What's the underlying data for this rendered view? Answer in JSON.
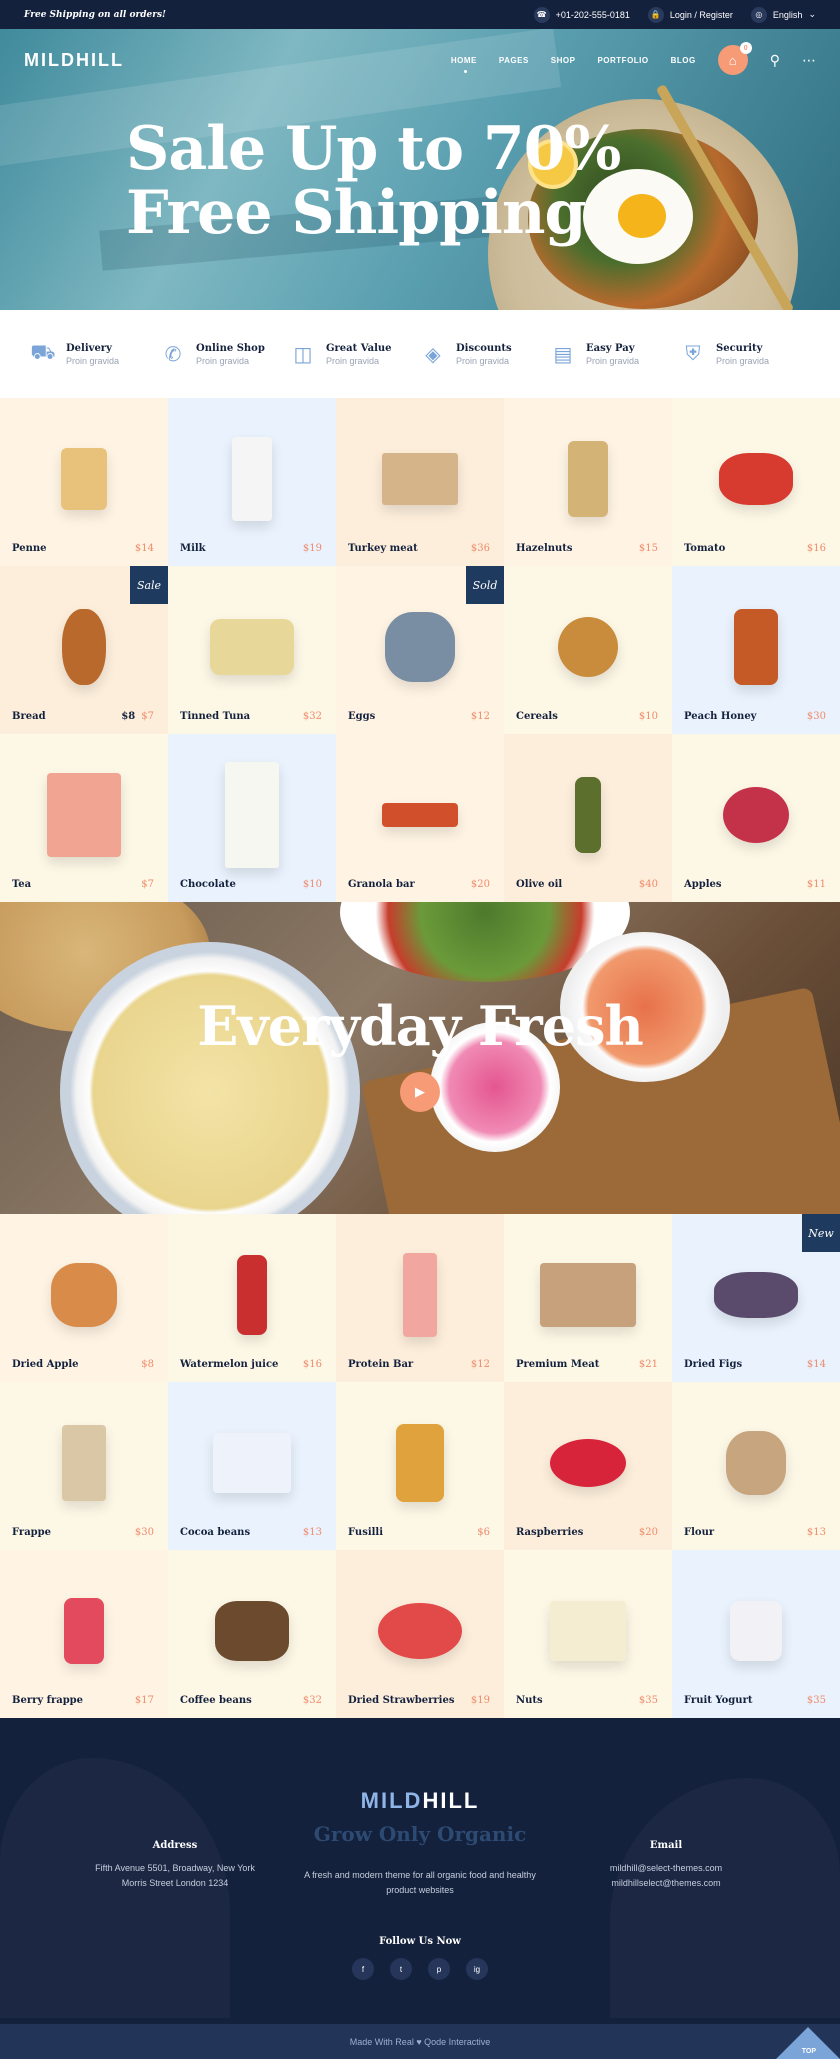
{
  "topbar": {
    "promo": "Free Shipping on all orders!",
    "phone": "+01-202-555-0181",
    "login": "Login / Register",
    "language": "English"
  },
  "header": {
    "logo": "MILDHILL",
    "nav": [
      "HOME",
      "PAGES",
      "SHOP",
      "PORTFOLIO",
      "BLOG"
    ],
    "cart_count": "0"
  },
  "hero": {
    "line1": "Sale Up to 70%",
    "line2": "Free Shipping"
  },
  "features": [
    {
      "title": "Delivery",
      "sub": "Proin gravida",
      "icon": "truck-icon"
    },
    {
      "title": "Online Shop",
      "sub": "Proin gravida",
      "icon": "phone-24-icon"
    },
    {
      "title": "Great Value",
      "sub": "Proin gravida",
      "icon": "box-icon"
    },
    {
      "title": "Discounts",
      "sub": "Proin gravida",
      "icon": "tag-icon"
    },
    {
      "title": "Easy Pay",
      "sub": "Proin gravida",
      "icon": "card-icon"
    },
    {
      "title": "Security",
      "sub": "Proin gravida",
      "icon": "shield-icon"
    }
  ],
  "products_top": [
    {
      "name": "Penne",
      "price": "$14",
      "old": "",
      "badge": ""
    },
    {
      "name": "Milk",
      "price": "$19",
      "old": "",
      "badge": ""
    },
    {
      "name": "Turkey meat",
      "price": "$36",
      "old": "",
      "badge": ""
    },
    {
      "name": "Hazelnuts",
      "price": "$15",
      "old": "",
      "badge": ""
    },
    {
      "name": "Tomato",
      "price": "$16",
      "old": "",
      "badge": ""
    },
    {
      "name": "Bread",
      "price": "$7",
      "old": "$8",
      "badge": "Sale"
    },
    {
      "name": "Tinned Tuna",
      "price": "$32",
      "old": "",
      "badge": ""
    },
    {
      "name": "Eggs",
      "price": "$12",
      "old": "",
      "badge": "Sold"
    },
    {
      "name": "Cereals",
      "price": "$10",
      "old": "",
      "badge": ""
    },
    {
      "name": "Peach Honey",
      "price": "$30",
      "old": "",
      "badge": ""
    },
    {
      "name": "Tea",
      "price": "$7",
      "old": "",
      "badge": ""
    },
    {
      "name": "Chocolate",
      "price": "$10",
      "old": "",
      "badge": ""
    },
    {
      "name": "Granola bar",
      "price": "$20",
      "old": "",
      "badge": ""
    },
    {
      "name": "Olive oil",
      "price": "$40",
      "old": "",
      "badge": ""
    },
    {
      "name": "Apples",
      "price": "$11",
      "old": "",
      "badge": ""
    }
  ],
  "fresh": {
    "title": "Everyday Fresh"
  },
  "products_bottom": [
    {
      "name": "Dried Apple",
      "price": "$8",
      "old": "",
      "badge": ""
    },
    {
      "name": "Watermelon juice",
      "price": "$16",
      "old": "",
      "badge": ""
    },
    {
      "name": "Protein Bar",
      "price": "$12",
      "old": "",
      "badge": ""
    },
    {
      "name": "Premium Meat",
      "price": "$21",
      "old": "",
      "badge": ""
    },
    {
      "name": "Dried Figs",
      "price": "$14",
      "old": "",
      "badge": "New"
    },
    {
      "name": "Frappe",
      "price": "$30",
      "old": "",
      "badge": ""
    },
    {
      "name": "Cocoa beans",
      "price": "$13",
      "old": "",
      "badge": ""
    },
    {
      "name": "Fusilli",
      "price": "$6",
      "old": "",
      "badge": ""
    },
    {
      "name": "Raspberries",
      "price": "$20",
      "old": "",
      "badge": ""
    },
    {
      "name": "Flour",
      "price": "$13",
      "old": "",
      "badge": ""
    },
    {
      "name": "Berry frappe",
      "price": "$17",
      "old": "",
      "badge": ""
    },
    {
      "name": "Coffee beans",
      "price": "$32",
      "old": "",
      "badge": ""
    },
    {
      "name": "Dried Strawberries",
      "price": "$19",
      "old": "",
      "badge": ""
    },
    {
      "name": "Nuts",
      "price": "$35",
      "old": "",
      "badge": ""
    },
    {
      "name": "Fruit Yogurt",
      "price": "$35",
      "old": "",
      "badge": ""
    }
  ],
  "footer": {
    "logo_a": "MILD",
    "logo_b": "HILL",
    "tagline": "Grow Only Organic",
    "desc": "A fresh and modern theme for all organic food and healthy product websites",
    "address_h": "Address",
    "address_1": "Fifth Avenue 5501, Broadway, New York",
    "address_2": "Morris Street London 1234",
    "email_h": "Email",
    "email_1": "mildhill@select-themes.com",
    "email_2": "mildhillselect@themes.com",
    "follow": "Follow Us Now",
    "socials": [
      "f",
      "t",
      "p",
      "ig"
    ],
    "bottom": "Made With Real ♥ Qode Interactive",
    "top_btn": "TOP"
  },
  "colors": {
    "navy": "#14213d",
    "accent": "#f79b77",
    "price": "#f08a6a",
    "badge": "#1f3a5f"
  }
}
